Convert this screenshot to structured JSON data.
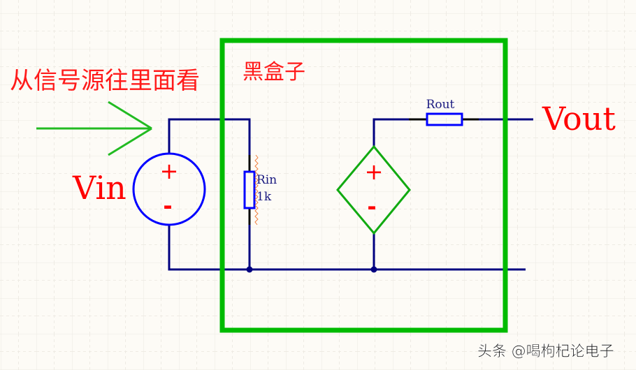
{
  "annotations": {
    "look_in_label": "从信号源往里面看",
    "black_box_label": "黑盒子",
    "vin_label": "Vin",
    "vout_label": "Vout"
  },
  "components": {
    "rin": {
      "name": "Rin",
      "value": "1k"
    },
    "rout": {
      "name": "Rout"
    },
    "vin_source": {
      "plus": "+",
      "minus": "-"
    },
    "dependent_source": {
      "plus": "+",
      "minus": "-"
    }
  },
  "watermark": "头条 @喝枸杞论电子",
  "colors": {
    "wire": "#000080",
    "component": "#0000ff",
    "box": "#00bb00",
    "label": "#ff0000",
    "arrow": "#22bb22",
    "grid": "#eceae3",
    "background": "#fdfbf6"
  }
}
